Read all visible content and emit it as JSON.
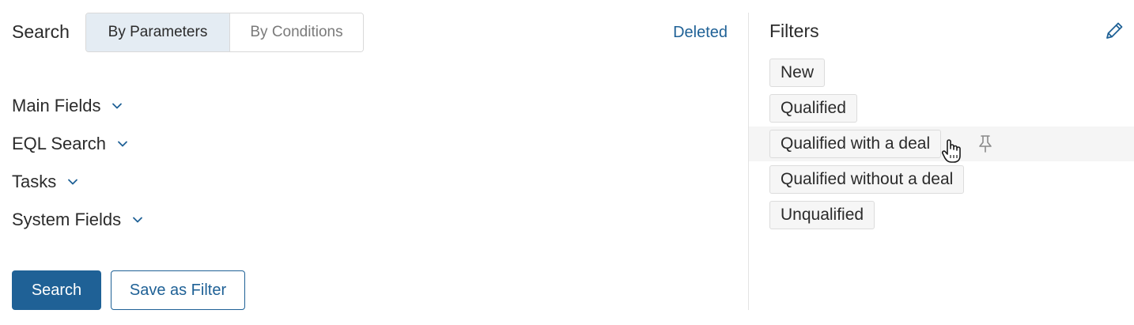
{
  "search": {
    "title": "Search",
    "tabs": [
      {
        "label": "By Parameters",
        "active": true
      },
      {
        "label": "By Conditions",
        "active": false
      }
    ],
    "deleted_link": "Deleted",
    "sections": [
      {
        "label": "Main Fields",
        "icon": "chevron-down-icon"
      },
      {
        "label": "EQL Search",
        "icon": "chevron-down-icon"
      },
      {
        "label": "Tasks",
        "icon": "chevron-down-icon"
      },
      {
        "label": "System Fields",
        "icon": "chevron-down-icon"
      }
    ],
    "search_button": "Search",
    "save_filter_button": "Save as Filter"
  },
  "filters": {
    "title": "Filters",
    "edit_icon": "pencil-icon",
    "items": [
      {
        "label": "New"
      },
      {
        "label": "Qualified"
      },
      {
        "label": "Qualified with a deal",
        "hovered": true,
        "pin_icon": "pin-icon"
      },
      {
        "label": "Qualified without a deal"
      },
      {
        "label": "Unqualified"
      }
    ]
  },
  "colors": {
    "accent": "#1f6196",
    "active_tab_bg": "#e4ecf3",
    "chip_bg": "#f6f6f6",
    "hover_row_bg": "#f5f5f5"
  }
}
